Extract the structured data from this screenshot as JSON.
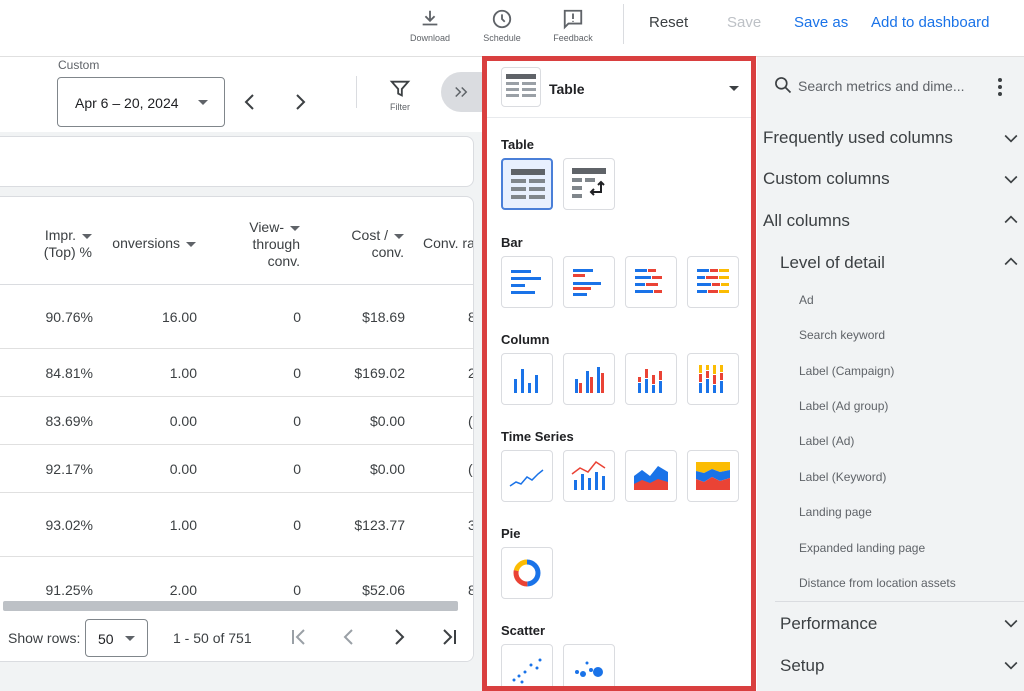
{
  "toolbar": {
    "download_label": "Download",
    "schedule_label": "Schedule",
    "feedback_label": "Feedback",
    "reset_label": "Reset",
    "save_label": "Save",
    "save_as_label": "Save as",
    "add_dashboard_label": "Add to dashboard"
  },
  "date_range": {
    "label": "Custom",
    "value": "Apr 6 – 20, 2024"
  },
  "filter_label": "Filter",
  "table": {
    "headers": {
      "impr_top_line1": "Impr.",
      "impr_top_line2": "(Top) %",
      "conversions": "onversions",
      "view_through_line1": "View-",
      "view_through_line2": "through",
      "view_through_line3": "conv.",
      "cost_conv_line1": "Cost /",
      "cost_conv_line2": "conv.",
      "conv_rate": "Conv. ra"
    },
    "rows": [
      {
        "impr": "90.76%",
        "conv": "16.00",
        "vtc": "0",
        "cost": "$18.69",
        "rate": "8"
      },
      {
        "impr": "84.81%",
        "conv": "1.00",
        "vtc": "0",
        "cost": "$169.02",
        "rate": "2"
      },
      {
        "impr": "83.69%",
        "conv": "0.00",
        "vtc": "0",
        "cost": "$0.00",
        "rate": "("
      },
      {
        "impr": "92.17%",
        "conv": "0.00",
        "vtc": "0",
        "cost": "$0.00",
        "rate": "("
      },
      {
        "impr": "93.02%",
        "conv": "1.00",
        "vtc": "0",
        "cost": "$123.77",
        "rate": "3"
      },
      {
        "impr": "91.25%",
        "conv": "2.00",
        "vtc": "0",
        "cost": "$52.06",
        "rate": "8"
      }
    ],
    "show_rows_label": "Show rows:",
    "rows_per_page": "50",
    "range_text": "1 - 50 of 751"
  },
  "chart_picker": {
    "selected": "Table",
    "sections": {
      "table": "Table",
      "bar": "Bar",
      "column": "Column",
      "time_series": "Time Series",
      "pie": "Pie",
      "scatter": "Scatter"
    }
  },
  "sidebar": {
    "search_placeholder": "Search metrics and dime...",
    "groups": {
      "frequent": "Frequently used columns",
      "custom": "Custom columns",
      "all": "All columns",
      "level": "Level of detail",
      "performance": "Performance",
      "setup": "Setup"
    },
    "level_items": [
      "Ad",
      "Search keyword",
      "Label (Campaign)",
      "Label (Ad group)",
      "Label (Ad)",
      "Label (Keyword)",
      "Landing page",
      "Expanded landing page",
      "Distance from location assets"
    ]
  },
  "colors": {
    "accent": "#1a73e8",
    "highlight_border": "#d93f3f",
    "chart_red": "#ea4335",
    "chart_yellow": "#fbbc04",
    "chart_blue": "#1a73e8"
  }
}
